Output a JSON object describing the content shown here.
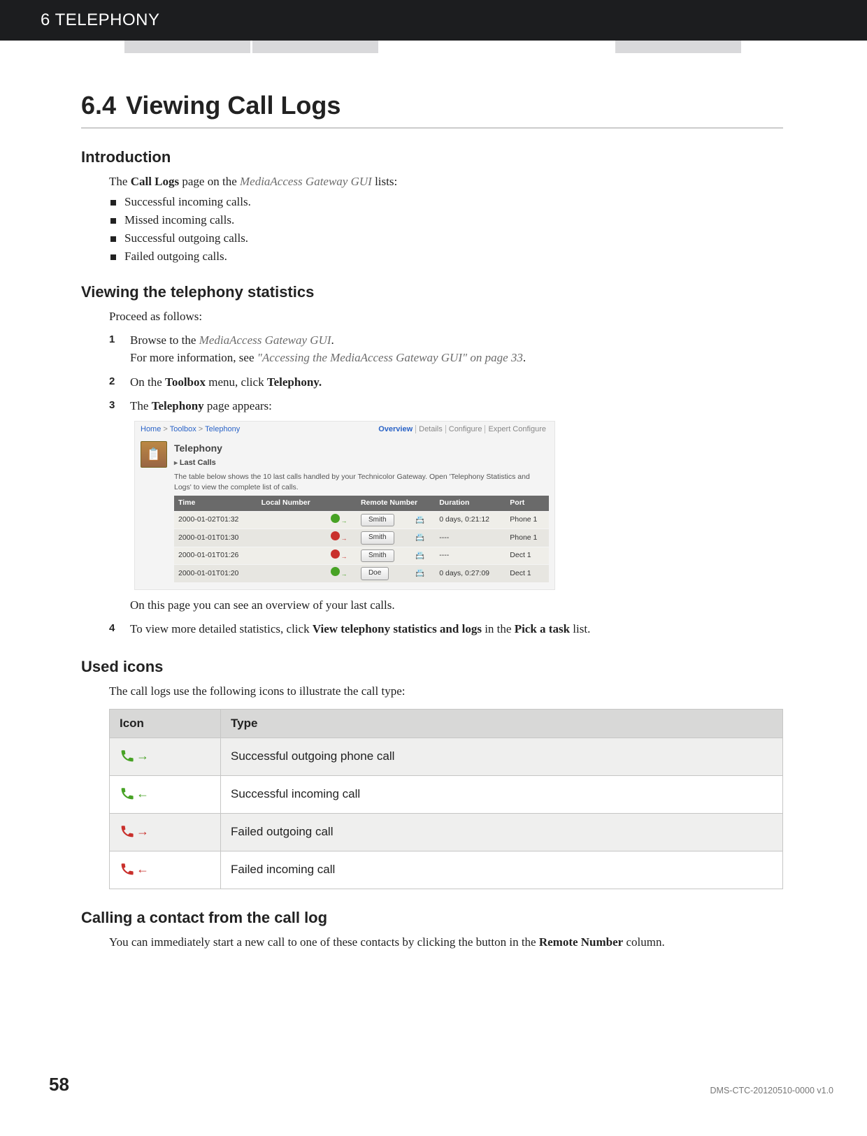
{
  "header": {
    "chapter": "6 TELEPHONY"
  },
  "section": {
    "number": "6.4",
    "title": "Viewing Call Logs"
  },
  "intro": {
    "heading": "Introduction",
    "lead_pre": "The ",
    "lead_bold": "Call Logs",
    "lead_mid": " page on the ",
    "lead_em": "MediaAccess Gateway GUI",
    "lead_post": " lists:",
    "bullets": [
      "Successful incoming calls.",
      "Missed incoming calls.",
      "Successful outgoing calls.",
      "Failed outgoing calls."
    ]
  },
  "viewing": {
    "heading": "Viewing the telephony statistics",
    "lead": "Proceed as follows:",
    "step1_a": "Browse to the ",
    "step1_em": "MediaAccess Gateway GUI",
    "step1_b": ".",
    "step1_c": "For more information, see ",
    "step1_link": "\"Accessing the MediaAccess Gateway GUI\" on page 33",
    "step1_d": ".",
    "step2_a": "On the ",
    "step2_b1": "Toolbox",
    "step2_c": " menu, click ",
    "step2_b2": "Telephony.",
    "step3_a": "The ",
    "step3_b": "Telephony",
    "step3_c": " page appears:",
    "step3_note": "On this page you can see an overview of your last calls.",
    "step4_a": "To view more detailed statistics, click ",
    "step4_b1": "View telephony statistics and logs",
    "step4_c": " in the ",
    "step4_b2": "Pick a task",
    "step4_d": " list."
  },
  "gui": {
    "breadcrumb": [
      "Home",
      "Toolbox",
      "Telephony"
    ],
    "tabs": [
      "Overview",
      "Details",
      "Configure",
      "Expert Configure"
    ],
    "title": "Telephony",
    "sub": "Last Calls",
    "desc": "The table below shows the 10 last calls handled by your Technicolor Gateway. Open 'Telephony Statistics and Logs' to view the complete list of calls.",
    "cols": [
      "Time",
      "Local Number",
      "",
      "Remote Number",
      "",
      "Duration",
      "Port"
    ],
    "rows": [
      {
        "time": "2000-01-02T01:32",
        "local": "",
        "dir": "out-ok",
        "remote": "Smith",
        "dur": "0 days, 0:21:12",
        "port": "Phone 1"
      },
      {
        "time": "2000-01-01T01:30",
        "local": "",
        "dir": "out-fail",
        "remote": "Smith",
        "dur": "----",
        "port": "Phone 1"
      },
      {
        "time": "2000-01-01T01:26",
        "local": "",
        "dir": "out-fail",
        "remote": "Smith",
        "dur": "----",
        "port": "Dect 1"
      },
      {
        "time": "2000-01-01T01:20",
        "local": "",
        "dir": "out-ok",
        "remote": "Doe",
        "dur": "0 days, 0:27:09",
        "port": "Dect 1"
      }
    ]
  },
  "icons": {
    "heading": "Used icons",
    "lead": "The call logs use the following icons to illustrate the call type:",
    "col1": "Icon",
    "col2": "Type",
    "rows": [
      {
        "kind": "out-ok",
        "label": "Successful outgoing phone call"
      },
      {
        "kind": "in-ok",
        "label": "Successful incoming call"
      },
      {
        "kind": "out-fail",
        "label": "Failed outgoing call"
      },
      {
        "kind": "in-fail",
        "label": "Failed incoming call"
      }
    ]
  },
  "calling": {
    "heading": "Calling a contact from the call log",
    "text_a": "You can immediately start a new call to one of these contacts by clicking the button in the ",
    "text_b": "Remote Number",
    "text_c": " column."
  },
  "footer": {
    "page": "58",
    "doc": "DMS-CTC-20120510-0000 v1.0"
  }
}
